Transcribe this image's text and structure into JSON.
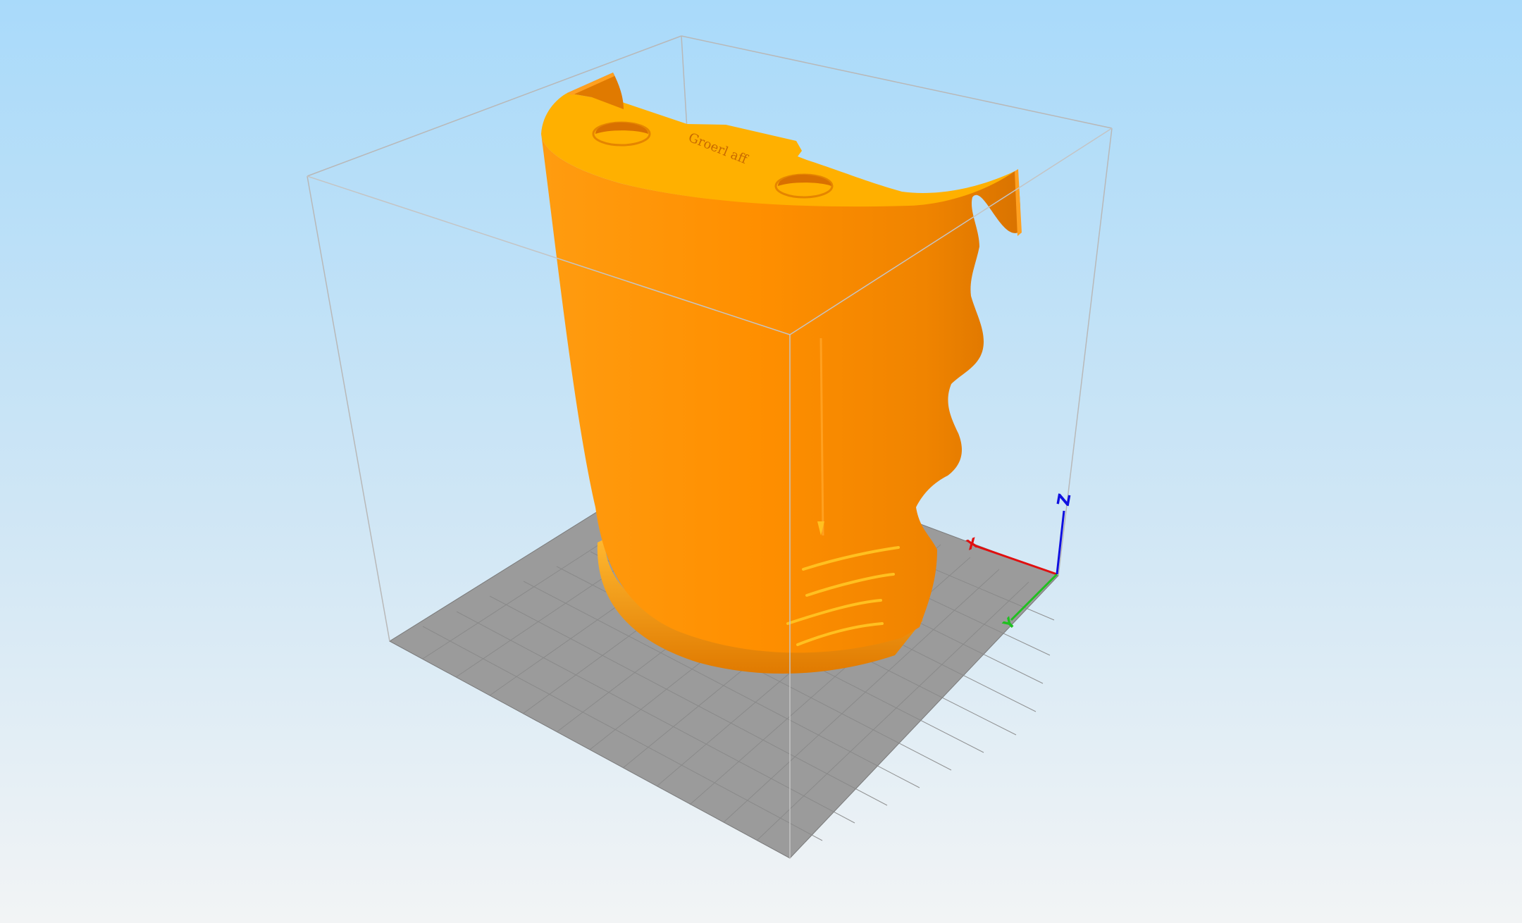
{
  "app": {
    "view": "3d-print-preview",
    "background_top": "#a9dafa",
    "background_bottom": "#f2f4f5"
  },
  "scene": {
    "model": {
      "color": "#ff9500",
      "top_color": "#ffb000",
      "dark_color": "#e07a00",
      "embossed_text": "Groerl aff"
    },
    "bed": {
      "color": "#9a9a9a",
      "grid_color": "#888888"
    },
    "axes": {
      "x": {
        "label": "X",
        "color": "#e01010"
      },
      "y": {
        "label": "Y",
        "color": "#20c020"
      },
      "z": {
        "label": "Z",
        "color": "#1010e0"
      }
    }
  }
}
